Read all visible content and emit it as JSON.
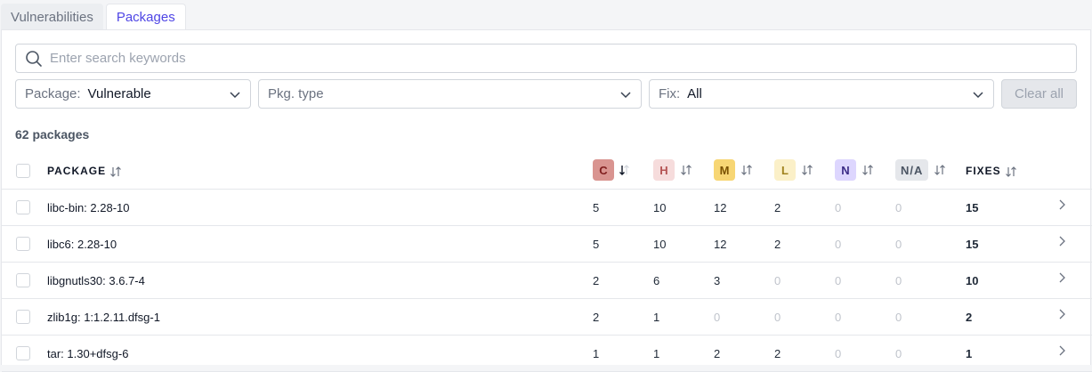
{
  "tabs": [
    {
      "label": "Vulnerabilities",
      "active": false
    },
    {
      "label": "Packages",
      "active": true
    }
  ],
  "search": {
    "placeholder": "Enter search keywords",
    "value": ""
  },
  "filters": {
    "package": {
      "label": "Package:",
      "value": "Vulnerable"
    },
    "pkg_type": {
      "placeholder": "Pkg. type"
    },
    "fix": {
      "label": "Fix:",
      "value": "All"
    },
    "clear_label": "Clear all"
  },
  "count_text": "62 packages",
  "columns": {
    "package": "PACKAGE",
    "critical": "C",
    "high": "H",
    "medium": "M",
    "low": "L",
    "negligible": "N",
    "na": "N/A",
    "fixes": "FIXES"
  },
  "severity_colors": {
    "critical": {
      "bg": "#d99490",
      "fg": "#7f1d1d"
    },
    "high": {
      "bg": "#f6dcdc",
      "fg": "#b45353"
    },
    "medium": {
      "bg": "#f7d674",
      "fg": "#7a5200"
    },
    "low": {
      "bg": "#fbf0c8",
      "fg": "#a0821e"
    },
    "negligible": {
      "bg": "#ddd6fe",
      "fg": "#3b2b86"
    },
    "na": {
      "bg": "#e5e7eb",
      "fg": "#4b5563"
    }
  },
  "rows": [
    {
      "package": "libc-bin: 2.28-10",
      "c": "5",
      "h": "10",
      "m": "12",
      "l": "2",
      "n": "0",
      "na": "0",
      "fixes": "15"
    },
    {
      "package": "libc6: 2.28-10",
      "c": "5",
      "h": "10",
      "m": "12",
      "l": "2",
      "n": "0",
      "na": "0",
      "fixes": "15"
    },
    {
      "package": "libgnutls30: 3.6.7-4",
      "c": "2",
      "h": "6",
      "m": "3",
      "l": "0",
      "n": "0",
      "na": "0",
      "fixes": "10"
    },
    {
      "package": "zlib1g: 1:1.2.11.dfsg-1",
      "c": "2",
      "h": "1",
      "m": "0",
      "l": "0",
      "n": "0",
      "na": "0",
      "fixes": "2"
    },
    {
      "package": "tar: 1.30+dfsg-6",
      "c": "1",
      "h": "1",
      "m": "2",
      "l": "2",
      "n": "0",
      "na": "0",
      "fixes": "1"
    }
  ],
  "icons": {
    "search": "search-icon",
    "chevron": "chevron-down-icon",
    "sort": "sort-icon",
    "row_arrow": "chevron-right-icon"
  }
}
